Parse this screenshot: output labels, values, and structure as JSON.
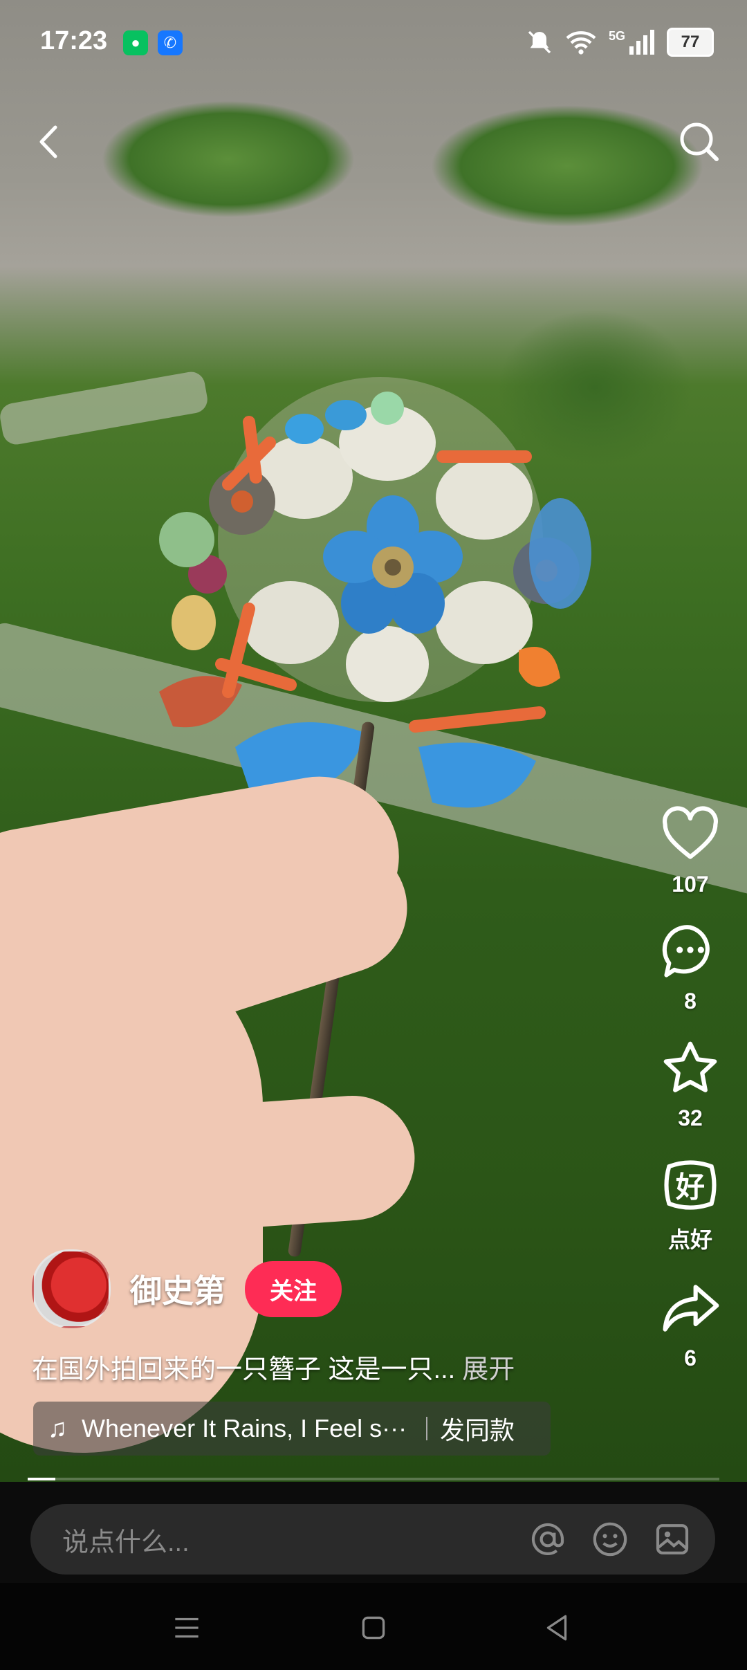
{
  "status_bar": {
    "time": "17:23",
    "network": "5G",
    "battery": "77"
  },
  "top": {
    "back_icon": "chevron-left-icon",
    "search_icon": "search-icon"
  },
  "actions": {
    "like_count": "107",
    "comment_count": "8",
    "favorite_count": "32",
    "good_label": "点好",
    "share_count": "6"
  },
  "author": {
    "name": "御史第",
    "follow_label": "关注"
  },
  "caption": {
    "text": "在国外拍回来的一只簪子 这是一只...",
    "more_label": "展开"
  },
  "music": {
    "title": "Whenever It Rains, I Feel s···",
    "same_label": "发同款"
  },
  "progress": 0.04,
  "comment_bar": {
    "placeholder": "说点什么..."
  },
  "colors": {
    "accent": "#fe2c55",
    "bar_bg": "#2a2a2a"
  }
}
